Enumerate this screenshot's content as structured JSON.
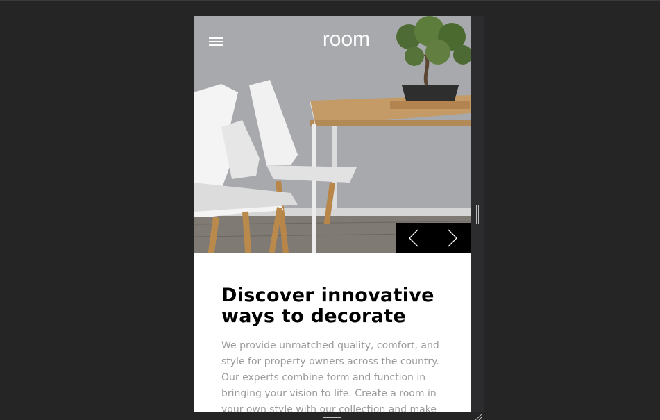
{
  "header": {
    "logo_text": "room",
    "menu_icon": "hamburger-menu-icon"
  },
  "hero": {
    "scene": "white-chairs-wood-table-bonsai",
    "prev_icon": "chevron-left-icon",
    "next_icon": "chevron-right-icon"
  },
  "content": {
    "headline_line1": "Discover innovative",
    "headline_line2": "ways to decorate",
    "body": "We provide unmatched quality, comfort, and style for property owners across the country. Our experts combine form and function in bringing your vision to life. Create a room in your own style with our collection and make"
  },
  "colors": {
    "page_background": "#252526",
    "accent_black": "#000000",
    "text_gray": "#9a9a9a"
  }
}
